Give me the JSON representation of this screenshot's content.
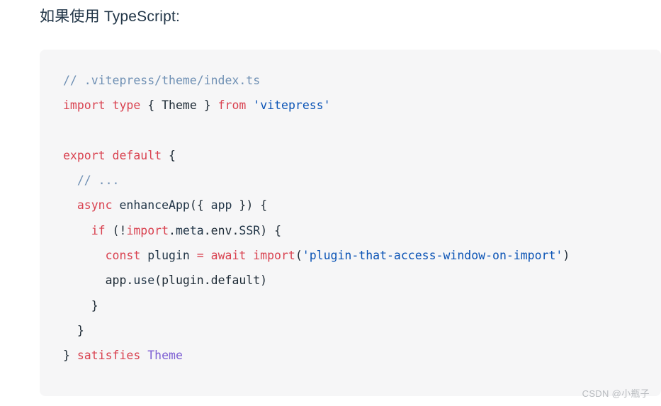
{
  "page": {
    "background_color": "#ffffff",
    "intro_text": "如果使用 TypeScript:"
  },
  "code_block": {
    "background_color": "#f6f6f7",
    "language": "typescript",
    "plain_text": "// .vitepress/theme/index.ts\nimport type { Theme } from 'vitepress'\n\nexport default {\n  // ...\n  async enhanceApp({ app }) {\n    if (!import.meta.env.SSR) {\n      const plugin = await import('plugin-that-access-window-on-import')\n      app.use(plugin.default)\n    }\n  }\n} satisfies Theme",
    "colors": {
      "comment": "#6f90b4",
      "keyword": "#d94250",
      "function": "#8250df",
      "parameter": "#e06c1f",
      "string": "#0a53b5",
      "variable": "#0a53b5",
      "property": "#0a53b5",
      "type": "#7d5fd3",
      "plain": "#1d2a35"
    },
    "lines": [
      {
        "n": 1,
        "tokens": [
          {
            "t": "// .vitepress/theme/index.ts",
            "c": "comment"
          }
        ]
      },
      {
        "n": 2,
        "tokens": [
          {
            "t": "import",
            "c": "keyword"
          },
          {
            "t": " ",
            "c": "plain"
          },
          {
            "t": "type",
            "c": "keyword"
          },
          {
            "t": " { ",
            "c": "plain"
          },
          {
            "t": "Theme",
            "c": "plain"
          },
          {
            "t": " } ",
            "c": "plain"
          },
          {
            "t": "from",
            "c": "keyword"
          },
          {
            "t": " ",
            "c": "plain"
          },
          {
            "t": "'vitepress'",
            "c": "string"
          }
        ]
      },
      {
        "n": 3,
        "tokens": []
      },
      {
        "n": 4,
        "tokens": [
          {
            "t": "export",
            "c": "keyword"
          },
          {
            "t": " ",
            "c": "plain"
          },
          {
            "t": "default",
            "c": "keyword"
          },
          {
            "t": " {",
            "c": "plain"
          }
        ]
      },
      {
        "n": 5,
        "tokens": [
          {
            "t": "  ",
            "c": "plain"
          },
          {
            "t": "// ...",
            "c": "comment"
          }
        ]
      },
      {
        "n": 6,
        "tokens": [
          {
            "t": "  ",
            "c": "plain"
          },
          {
            "t": "async",
            "c": "keyword"
          },
          {
            "t": " ",
            "c": "plain"
          },
          {
            "t": "enhanceApp",
            "c": "function"
          },
          {
            "t": "({ ",
            "c": "plain"
          },
          {
            "t": "app",
            "c": "parameter"
          },
          {
            "t": " }) {",
            "c": "plain"
          }
        ]
      },
      {
        "n": 7,
        "tokens": [
          {
            "t": "    ",
            "c": "plain"
          },
          {
            "t": "if",
            "c": "keyword"
          },
          {
            "t": " (!",
            "c": "plain"
          },
          {
            "t": "import",
            "c": "keyword"
          },
          {
            "t": ".",
            "c": "plain"
          },
          {
            "t": "meta",
            "c": "property"
          },
          {
            "t": ".env.",
            "c": "plain"
          },
          {
            "t": "SSR",
            "c": "property"
          },
          {
            "t": ") {",
            "c": "plain"
          }
        ]
      },
      {
        "n": 8,
        "tokens": [
          {
            "t": "      ",
            "c": "plain"
          },
          {
            "t": "const",
            "c": "keyword"
          },
          {
            "t": " ",
            "c": "plain"
          },
          {
            "t": "plugin",
            "c": "variable"
          },
          {
            "t": " ",
            "c": "plain"
          },
          {
            "t": "=",
            "c": "keyword"
          },
          {
            "t": " ",
            "c": "plain"
          },
          {
            "t": "await",
            "c": "keyword"
          },
          {
            "t": " ",
            "c": "plain"
          },
          {
            "t": "import",
            "c": "keyword"
          },
          {
            "t": "(",
            "c": "plain"
          },
          {
            "t": "'plugin-that-access-window-on-import'",
            "c": "string"
          },
          {
            "t": ")",
            "c": "plain"
          }
        ]
      },
      {
        "n": 9,
        "tokens": [
          {
            "t": "      ",
            "c": "plain"
          },
          {
            "t": "app",
            "c": "plain"
          },
          {
            "t": ".",
            "c": "plain"
          },
          {
            "t": "use",
            "c": "function"
          },
          {
            "t": "(plugin.default)",
            "c": "plain"
          }
        ]
      },
      {
        "n": 10,
        "tokens": [
          {
            "t": "    }",
            "c": "plain"
          }
        ]
      },
      {
        "n": 11,
        "tokens": [
          {
            "t": "  }",
            "c": "plain"
          }
        ]
      },
      {
        "n": 12,
        "tokens": [
          {
            "t": "} ",
            "c": "plain"
          },
          {
            "t": "satisfies",
            "c": "keyword"
          },
          {
            "t": " ",
            "c": "plain"
          },
          {
            "t": "Theme",
            "c": "type"
          }
        ]
      }
    ]
  },
  "watermark": {
    "text": "CSDN @小瓶子"
  }
}
